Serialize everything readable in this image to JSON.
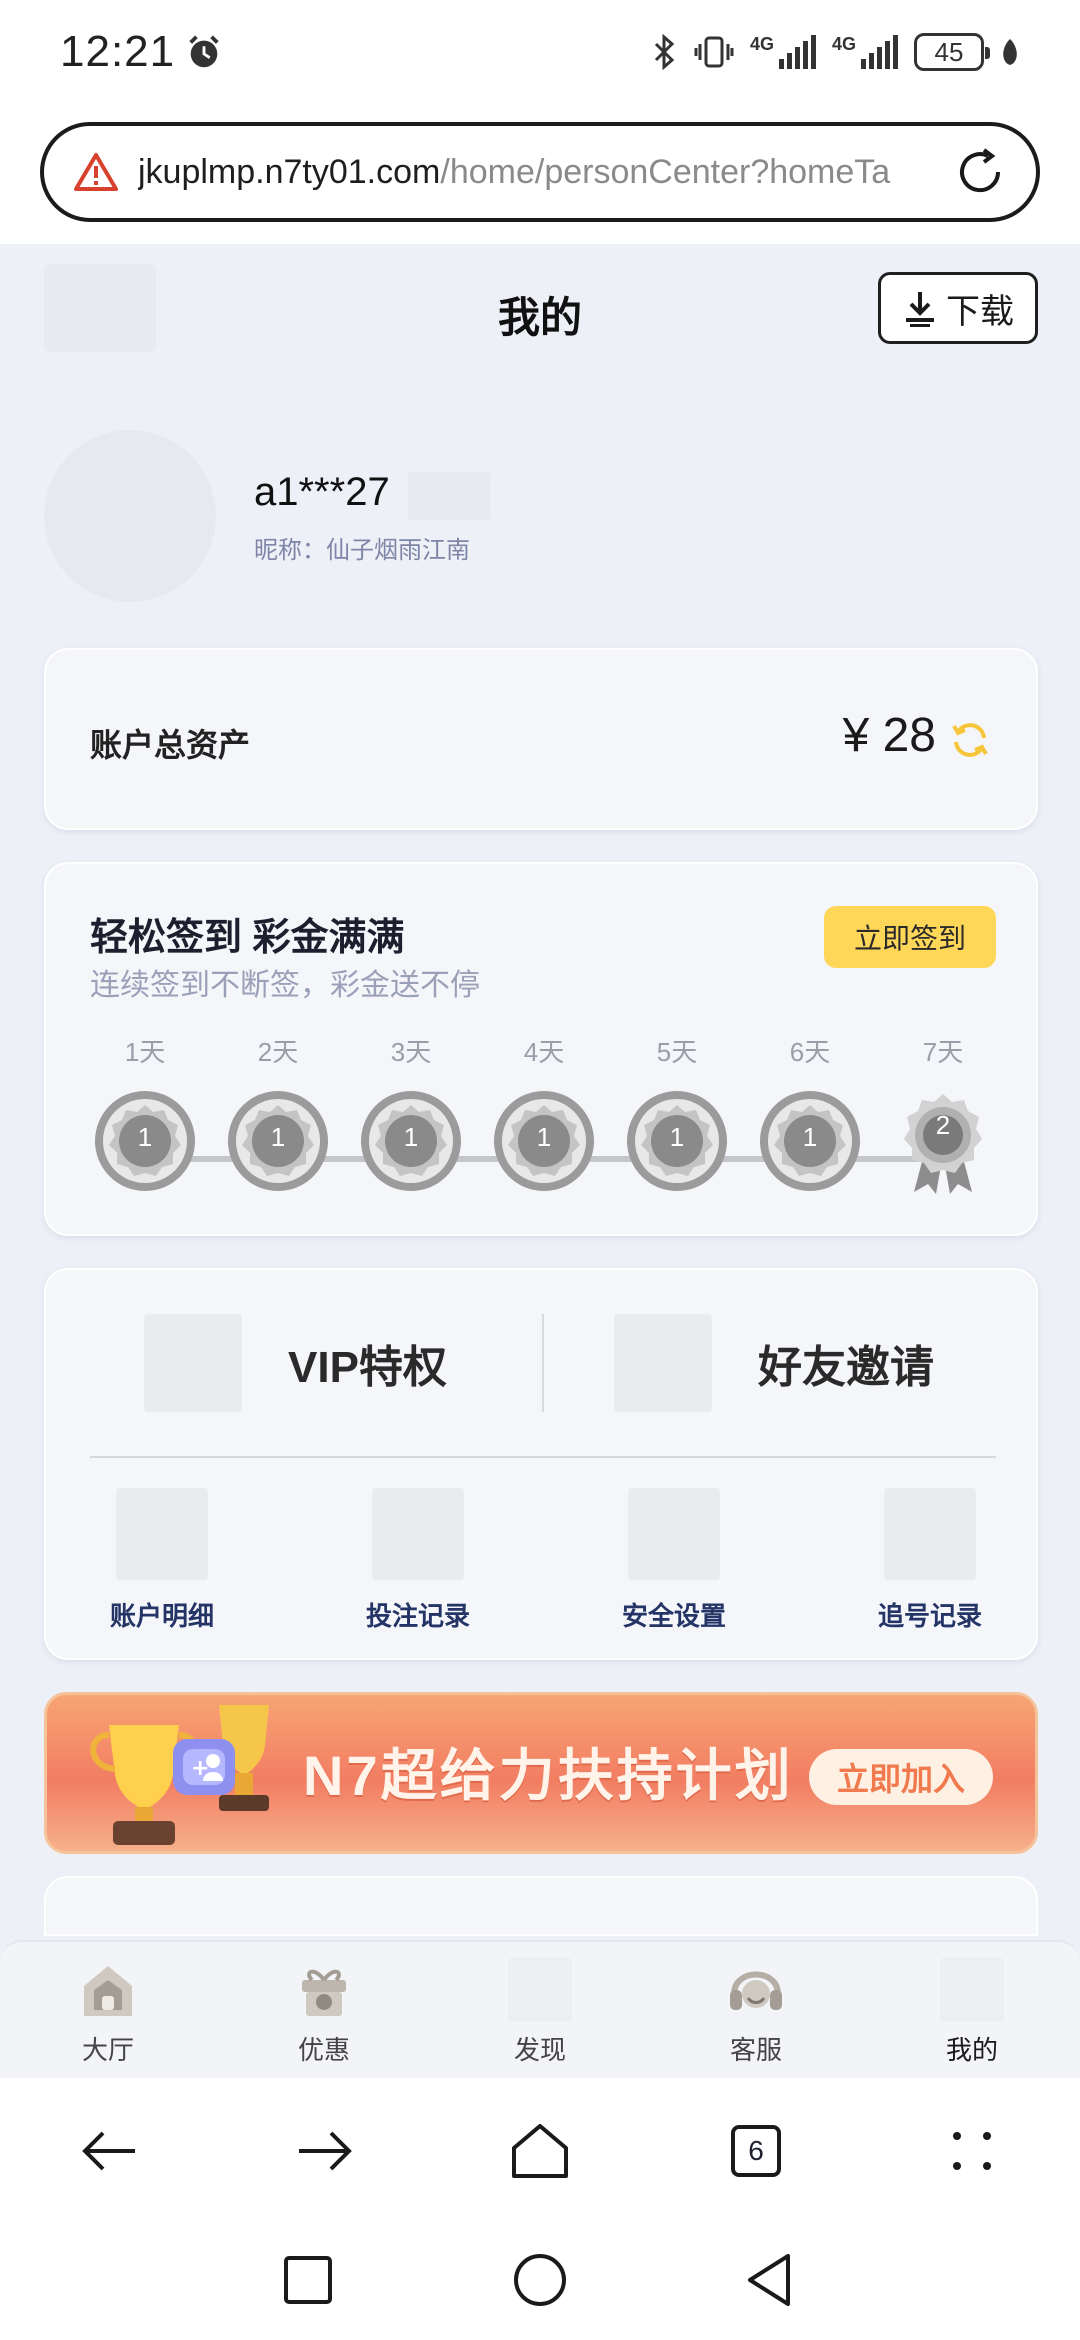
{
  "status_bar": {
    "time": "12:21",
    "network_1": "4G",
    "network_2": "4G",
    "battery": "45"
  },
  "url_bar": {
    "host": "jkuplmp.n7ty01.com",
    "path": "/home/personCenter?homeTa"
  },
  "header": {
    "title": "我的",
    "download_label": "下载"
  },
  "profile": {
    "username": "a1***27",
    "nickname": "昵称：仙子烟雨江南"
  },
  "assets": {
    "label": "账户总资产",
    "value": "¥ 28"
  },
  "signin": {
    "title": "轻松签到 彩金满满",
    "subtitle": "连续签到不断签，彩金送不停",
    "button": "立即签到",
    "days": [
      {
        "label": "1天",
        "reward": "1"
      },
      {
        "label": "2天",
        "reward": "1"
      },
      {
        "label": "3天",
        "reward": "1"
      },
      {
        "label": "4天",
        "reward": "1"
      },
      {
        "label": "5天",
        "reward": "1"
      },
      {
        "label": "6天",
        "reward": "1"
      },
      {
        "label": "7天",
        "reward": "2"
      }
    ]
  },
  "menu": {
    "vip": "VIP特权",
    "invite": "好友邀请",
    "items": [
      {
        "label": "账户明细"
      },
      {
        "label": "投注记录"
      },
      {
        "label": "安全设置"
      },
      {
        "label": "追号记录"
      }
    ]
  },
  "banner": {
    "text": "N7超给力扶持计划",
    "button": "立即加入"
  },
  "tabbar": {
    "items": [
      {
        "label": "大厅",
        "icon": "home-icon"
      },
      {
        "label": "优惠",
        "icon": "gift-icon"
      },
      {
        "label": "发现",
        "icon": "discover-icon"
      },
      {
        "label": "客服",
        "icon": "headset-icon"
      },
      {
        "label": "我的",
        "icon": "profile-icon"
      }
    ]
  },
  "browser": {
    "tab_count": "6"
  },
  "colors": {
    "accent_yellow": "#ffd758",
    "banner_orange": "#f27d62",
    "menu_label": "#243466"
  }
}
